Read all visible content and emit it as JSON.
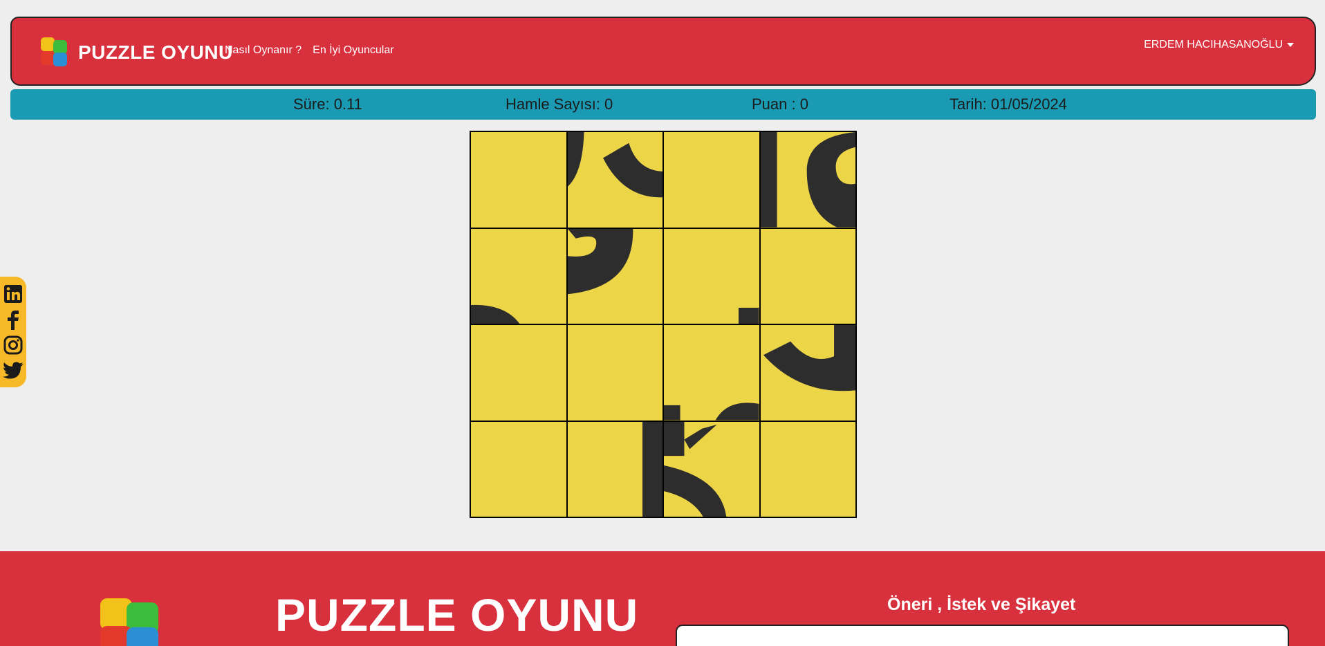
{
  "navbar": {
    "brand": "PUZZLE OYUNU",
    "links": [
      "Nasıl Oynanır ?",
      "En İyi Oyuncular"
    ],
    "user": "ERDEM HACIHASANOĞLU"
  },
  "stats": {
    "time": "Süre: 0.11",
    "moves": "Hamle Sayısı: 0",
    "score": "Puan : 0",
    "date": "Tarih: 01/05/2024"
  },
  "board": {
    "tile_color": "#edd548",
    "shape_color": "#2d2d2d",
    "tiles": 16
  },
  "social": [
    "linkedin-icon",
    "facebook-icon",
    "instagram-icon",
    "twitter-icon"
  ],
  "footer": {
    "title": "PUZZLE OYUNU",
    "feedback_title": "Öneri , İstek ve Şikayet"
  },
  "colors": {
    "primary": "#d9303d",
    "accent": "#1a9bb3",
    "tile": "#edd548"
  }
}
